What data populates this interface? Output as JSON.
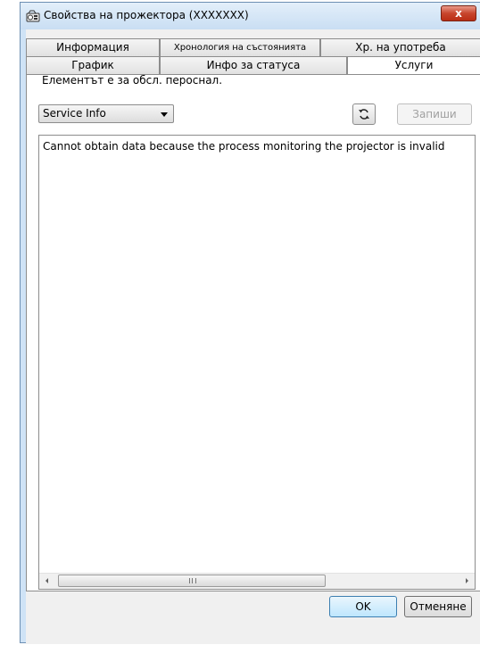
{
  "window": {
    "title": "Свойства на прожектора (XXXXXXX)",
    "close_label": "x"
  },
  "tabs": {
    "row1": [
      {
        "label": "Информация"
      },
      {
        "label": "Хронология на състоянията"
      },
      {
        "label": "Хр. на употреба"
      }
    ],
    "row2": [
      {
        "label": "График"
      },
      {
        "label": "Инфо за статуса"
      },
      {
        "label": "Услуги",
        "active": true
      }
    ]
  },
  "services": {
    "staff_label": "Елементът е за обсл. пероснал.",
    "combo_value": "Service Info",
    "write_label": "Запиши",
    "message": "Cannot obtain data because the process monitoring the projector is invalid",
    "scroll_grip": "III"
  },
  "footer": {
    "ok_label": "OK",
    "cancel_label": "Отменяне"
  },
  "icons": {
    "title": "projector-icon",
    "refresh": "refresh-icon",
    "close": "close-icon"
  }
}
